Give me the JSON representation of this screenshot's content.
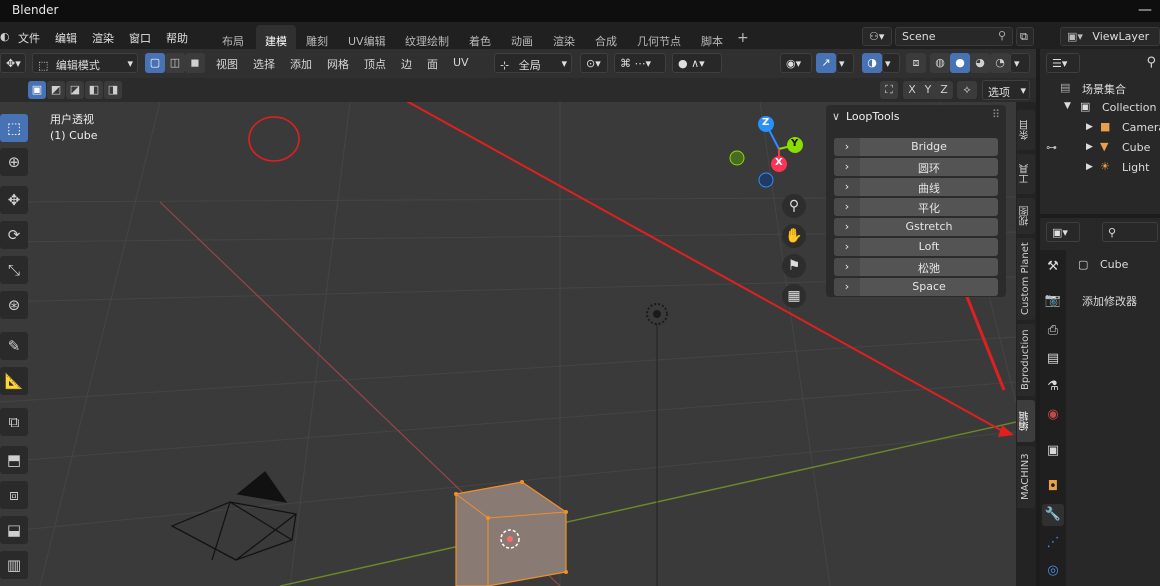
{
  "window": {
    "title": "Blender"
  },
  "menus": [
    "文件",
    "编辑",
    "渲染",
    "窗口",
    "帮助"
  ],
  "workspaces": [
    "布局",
    "建模",
    "雕刻",
    "UV编辑",
    "纹理绘制",
    "着色",
    "动画",
    "渲染",
    "合成",
    "几何节点",
    "脚本"
  ],
  "workspace_add": "+",
  "scene": {
    "label": "Scene",
    "view_layer": "ViewLayer"
  },
  "header": {
    "mode": "编辑模式",
    "menu": [
      "视图",
      "选择",
      "添加",
      "网格",
      "顶点",
      "边",
      "面",
      "UV"
    ],
    "orientation": "全局",
    "axes": [
      "X",
      "Y",
      "Z"
    ],
    "options": "选项"
  },
  "viewport": {
    "view_name": "用户透视",
    "object_label": "(1) Cube",
    "gizmo_axes": [
      "Z",
      "Y",
      "X"
    ]
  },
  "loop_tools": {
    "title": "LoopTools",
    "items": [
      "Bridge",
      "圆环",
      "曲线",
      "平化",
      "Gstretch",
      "Loft",
      "松弛",
      "Space"
    ]
  },
  "sidebar_tabs": [
    "条目",
    "工具",
    "视图",
    "Custom Planet",
    "Bproduction",
    "编辑",
    "MACHIN3"
  ],
  "outliner": {
    "root": "场景集合",
    "collection": "Collection",
    "objects": [
      "Camera",
      "Cube",
      "Light"
    ]
  },
  "properties": {
    "object": "Cube",
    "add_modifier": "添加修改器"
  },
  "colors": {
    "accent": "#4772b3",
    "annotation": "#e02020",
    "x_axis": "#ff3352",
    "y_axis": "#8bdc00",
    "z_axis": "#2890ff",
    "selection_orange": "#f0902a"
  }
}
